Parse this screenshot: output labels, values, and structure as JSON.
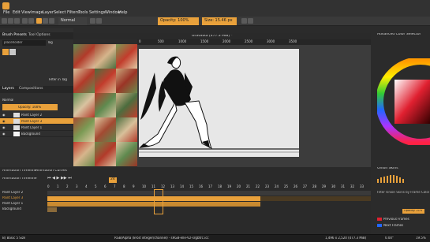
{
  "menu": {
    "items": [
      "File",
      "Edit",
      "View",
      "Image",
      "Layer",
      "Select",
      "Filters",
      "Tools",
      "Settings",
      "Window",
      "Help"
    ]
  },
  "toolbar": {
    "mode": "Normal",
    "opacity": "Opacity: 100%",
    "size": "Size: 15.46 px"
  },
  "panels": {
    "brush_presets": "Brush Presets",
    "tool_options": "Tool Options",
    "preset_name": "placeholder",
    "tag": "Tag",
    "filter_in_tag": "Filter in Tag",
    "layers_tab": "Layers",
    "compositions_tab": "Compositions",
    "blend_mode": "Normal",
    "layer_opacity": "Opacity: 100%",
    "layers": [
      "Paint Layer 2",
      "Paint Layer 3",
      "Paint Layer 1",
      "Background"
    ]
  },
  "canvas": {
    "title": "Gravatka [477.3 MiB] *",
    "ruler_ticks": [
      "0",
      "500",
      "1000",
      "1500",
      "2000",
      "2500",
      "3000",
      "3500"
    ]
  },
  "right_panel": {
    "title": "Advanced Color Selector",
    "onion_title": "Onion Skins",
    "filter_label": "Filter Onion Skins by Frame Color",
    "opacity_label": "Opacity: 21%",
    "previous_frames": "Previous Frames",
    "next_frames": "Next Frames"
  },
  "timeline": {
    "tabs": [
      "Animation Timeline",
      "Animation Curves"
    ],
    "header": "Animation Timeline",
    "fps": "24",
    "frame_numbers": [
      "0",
      "1",
      "2",
      "3",
      "4",
      "5",
      "6",
      "7",
      "8",
      "9",
      "10",
      "11",
      "12",
      "13",
      "14",
      "15",
      "16",
      "17",
      "18",
      "19",
      "20",
      "21",
      "22",
      "23",
      "24",
      "25",
      "26",
      "27",
      "28",
      "29",
      "30",
      "31",
      "32",
      "33"
    ],
    "rows": [
      "Paint Layer 2",
      "Paint Layer 3",
      "Paint Layer 1",
      "Background"
    ]
  },
  "status": {
    "left": "B) Basic 5 Size",
    "center": "RGB/Alpha (8-bit integer/channel) · sRGB-elle-V2-srgbtrc.icc",
    "right": "1,496 x 2,520 (477.3 MiB)",
    "zoom": "0.00°",
    "pct": "19.5%"
  },
  "colors": {
    "accent": "#e9a13b",
    "panel": "#2f2f2f",
    "canvas_bg": "#3c3c3c",
    "paper": "#e7e7e7",
    "fg_swatch": "#e02030"
  }
}
